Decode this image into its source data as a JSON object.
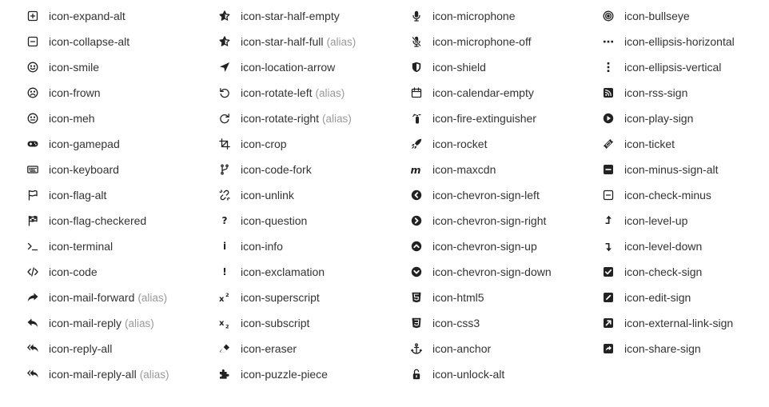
{
  "alias_text": "(alias)",
  "columns": [
    [
      {
        "name": "icon-expand-alt",
        "icon": "expand-alt-icon"
      },
      {
        "name": "icon-collapse-alt",
        "icon": "collapse-alt-icon"
      },
      {
        "name": "icon-smile",
        "icon": "smile-icon"
      },
      {
        "name": "icon-frown",
        "icon": "frown-icon"
      },
      {
        "name": "icon-meh",
        "icon": "meh-icon"
      },
      {
        "name": "icon-gamepad",
        "icon": "gamepad-icon"
      },
      {
        "name": "icon-keyboard",
        "icon": "keyboard-icon"
      },
      {
        "name": "icon-flag-alt",
        "icon": "flag-alt-icon"
      },
      {
        "name": "icon-flag-checkered",
        "icon": "flag-checkered-icon"
      },
      {
        "name": "icon-terminal",
        "icon": "terminal-icon"
      },
      {
        "name": "icon-code",
        "icon": "code-icon"
      },
      {
        "name": "icon-mail-forward",
        "icon": "mail-forward-icon",
        "alias": true
      },
      {
        "name": "icon-mail-reply",
        "icon": "mail-reply-icon",
        "alias": true
      },
      {
        "name": "icon-reply-all",
        "icon": "reply-all-icon"
      },
      {
        "name": "icon-mail-reply-all",
        "icon": "mail-reply-all-icon",
        "alias": true
      }
    ],
    [
      {
        "name": "icon-star-half-empty",
        "icon": "star-half-empty-icon"
      },
      {
        "name": "icon-star-half-full",
        "icon": "star-half-full-icon",
        "alias": true
      },
      {
        "name": "icon-location-arrow",
        "icon": "location-arrow-icon"
      },
      {
        "name": "icon-rotate-left",
        "icon": "rotate-left-icon",
        "alias": true
      },
      {
        "name": "icon-rotate-right",
        "icon": "rotate-right-icon",
        "alias": true
      },
      {
        "name": "icon-crop",
        "icon": "crop-icon"
      },
      {
        "name": "icon-code-fork",
        "icon": "code-fork-icon"
      },
      {
        "name": "icon-unlink",
        "icon": "unlink-icon"
      },
      {
        "name": "icon-question",
        "icon": "question-icon"
      },
      {
        "name": "icon-info",
        "icon": "info-icon"
      },
      {
        "name": "icon-exclamation",
        "icon": "exclamation-icon"
      },
      {
        "name": "icon-superscript",
        "icon": "superscript-icon"
      },
      {
        "name": "icon-subscript",
        "icon": "subscript-icon"
      },
      {
        "name": "icon-eraser",
        "icon": "eraser-icon"
      },
      {
        "name": "icon-puzzle-piece",
        "icon": "puzzle-piece-icon"
      }
    ],
    [
      {
        "name": "icon-microphone",
        "icon": "microphone-icon"
      },
      {
        "name": "icon-microphone-off",
        "icon": "microphone-off-icon"
      },
      {
        "name": "icon-shield",
        "icon": "shield-icon"
      },
      {
        "name": "icon-calendar-empty",
        "icon": "calendar-empty-icon"
      },
      {
        "name": "icon-fire-extinguisher",
        "icon": "fire-extinguisher-icon"
      },
      {
        "name": "icon-rocket",
        "icon": "rocket-icon"
      },
      {
        "name": "icon-maxcdn",
        "icon": "maxcdn-icon"
      },
      {
        "name": "icon-chevron-sign-left",
        "icon": "chevron-sign-left-icon"
      },
      {
        "name": "icon-chevron-sign-right",
        "icon": "chevron-sign-right-icon"
      },
      {
        "name": "icon-chevron-sign-up",
        "icon": "chevron-sign-up-icon"
      },
      {
        "name": "icon-chevron-sign-down",
        "icon": "chevron-sign-down-icon"
      },
      {
        "name": "icon-html5",
        "icon": "html5-icon"
      },
      {
        "name": "icon-css3",
        "icon": "css3-icon"
      },
      {
        "name": "icon-anchor",
        "icon": "anchor-icon"
      },
      {
        "name": "icon-unlock-alt",
        "icon": "unlock-alt-icon"
      }
    ],
    [
      {
        "name": "icon-bullseye",
        "icon": "bullseye-icon"
      },
      {
        "name": "icon-ellipsis-horizontal",
        "icon": "ellipsis-horizontal-icon"
      },
      {
        "name": "icon-ellipsis-vertical",
        "icon": "ellipsis-vertical-icon"
      },
      {
        "name": "icon-rss-sign",
        "icon": "rss-sign-icon"
      },
      {
        "name": "icon-play-sign",
        "icon": "play-sign-icon"
      },
      {
        "name": "icon-ticket",
        "icon": "ticket-icon"
      },
      {
        "name": "icon-minus-sign-alt",
        "icon": "minus-sign-alt-icon"
      },
      {
        "name": "icon-check-minus",
        "icon": "check-minus-icon"
      },
      {
        "name": "icon-level-up",
        "icon": "level-up-icon"
      },
      {
        "name": "icon-level-down",
        "icon": "level-down-icon"
      },
      {
        "name": "icon-check-sign",
        "icon": "check-sign-icon"
      },
      {
        "name": "icon-edit-sign",
        "icon": "edit-sign-icon"
      },
      {
        "name": "icon-external-link-sign",
        "icon": "external-link-sign-icon"
      },
      {
        "name": "icon-share-sign",
        "icon": "share-sign-icon"
      }
    ]
  ]
}
